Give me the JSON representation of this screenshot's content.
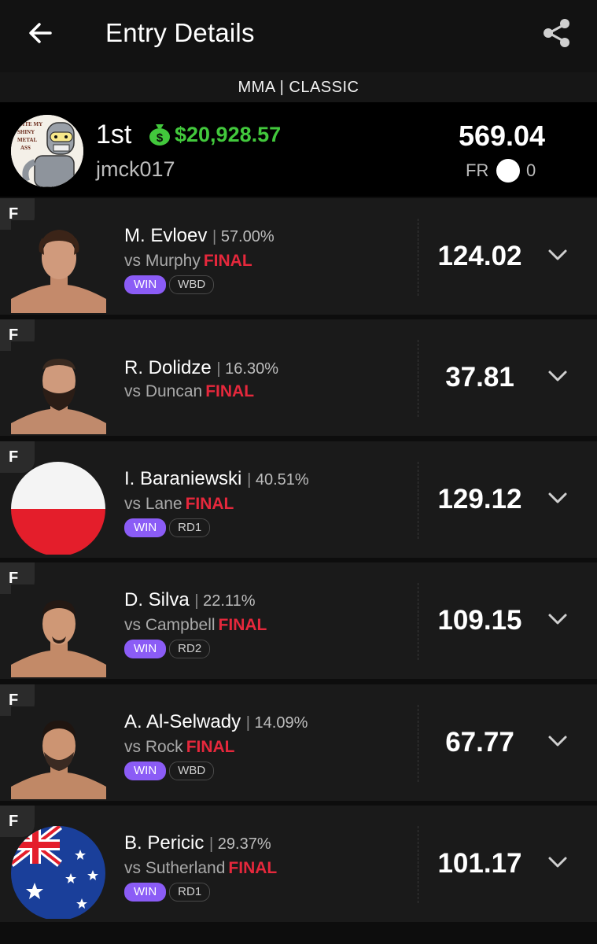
{
  "header": {
    "title": "Entry Details",
    "subheader": "MMA | CLASSIC"
  },
  "entry": {
    "rank": "1st",
    "prize": "$20,928.57",
    "username": "jmck017",
    "total_points": "569.04",
    "fr_label": "FR",
    "fr_value": "0",
    "avatar_text": "BITE MY SHINY METAL ASS"
  },
  "colors": {
    "prize_green": "#42c83c",
    "final_red": "#e6283c",
    "win_purple": "#8b5cf6"
  },
  "fighters": [
    {
      "position": "F",
      "name": "M. Evloev",
      "ownership": "57.00%",
      "opponent": "vs Murphy",
      "status": "FINAL",
      "result": "WIN",
      "method": "WBD",
      "points": "124.02",
      "image": "fighter-photo"
    },
    {
      "position": "F",
      "name": "R. Dolidze",
      "ownership": "16.30%",
      "opponent": "vs Duncan",
      "status": "FINAL",
      "result": "",
      "method": "",
      "points": "37.81",
      "image": "fighter-photo"
    },
    {
      "position": "F",
      "name": "I. Baraniewski",
      "ownership": "40.51%",
      "opponent": "vs Lane",
      "status": "FINAL",
      "result": "WIN",
      "method": "RD1",
      "points": "129.12",
      "image": "poland-flag"
    },
    {
      "position": "F",
      "name": "D. Silva",
      "ownership": "22.11%",
      "opponent": "vs Campbell",
      "status": "FINAL",
      "result": "WIN",
      "method": "RD2",
      "points": "109.15",
      "image": "fighter-photo"
    },
    {
      "position": "F",
      "name": "A. Al-Selwady",
      "ownership": "14.09%",
      "opponent": "vs Rock",
      "status": "FINAL",
      "result": "WIN",
      "method": "WBD",
      "points": "67.77",
      "image": "fighter-photo"
    },
    {
      "position": "F",
      "name": "B. Pericic",
      "ownership": "29.37%",
      "opponent": "vs Sutherland",
      "status": "FINAL",
      "result": "WIN",
      "method": "RD1",
      "points": "101.17",
      "image": "australia-flag"
    }
  ]
}
